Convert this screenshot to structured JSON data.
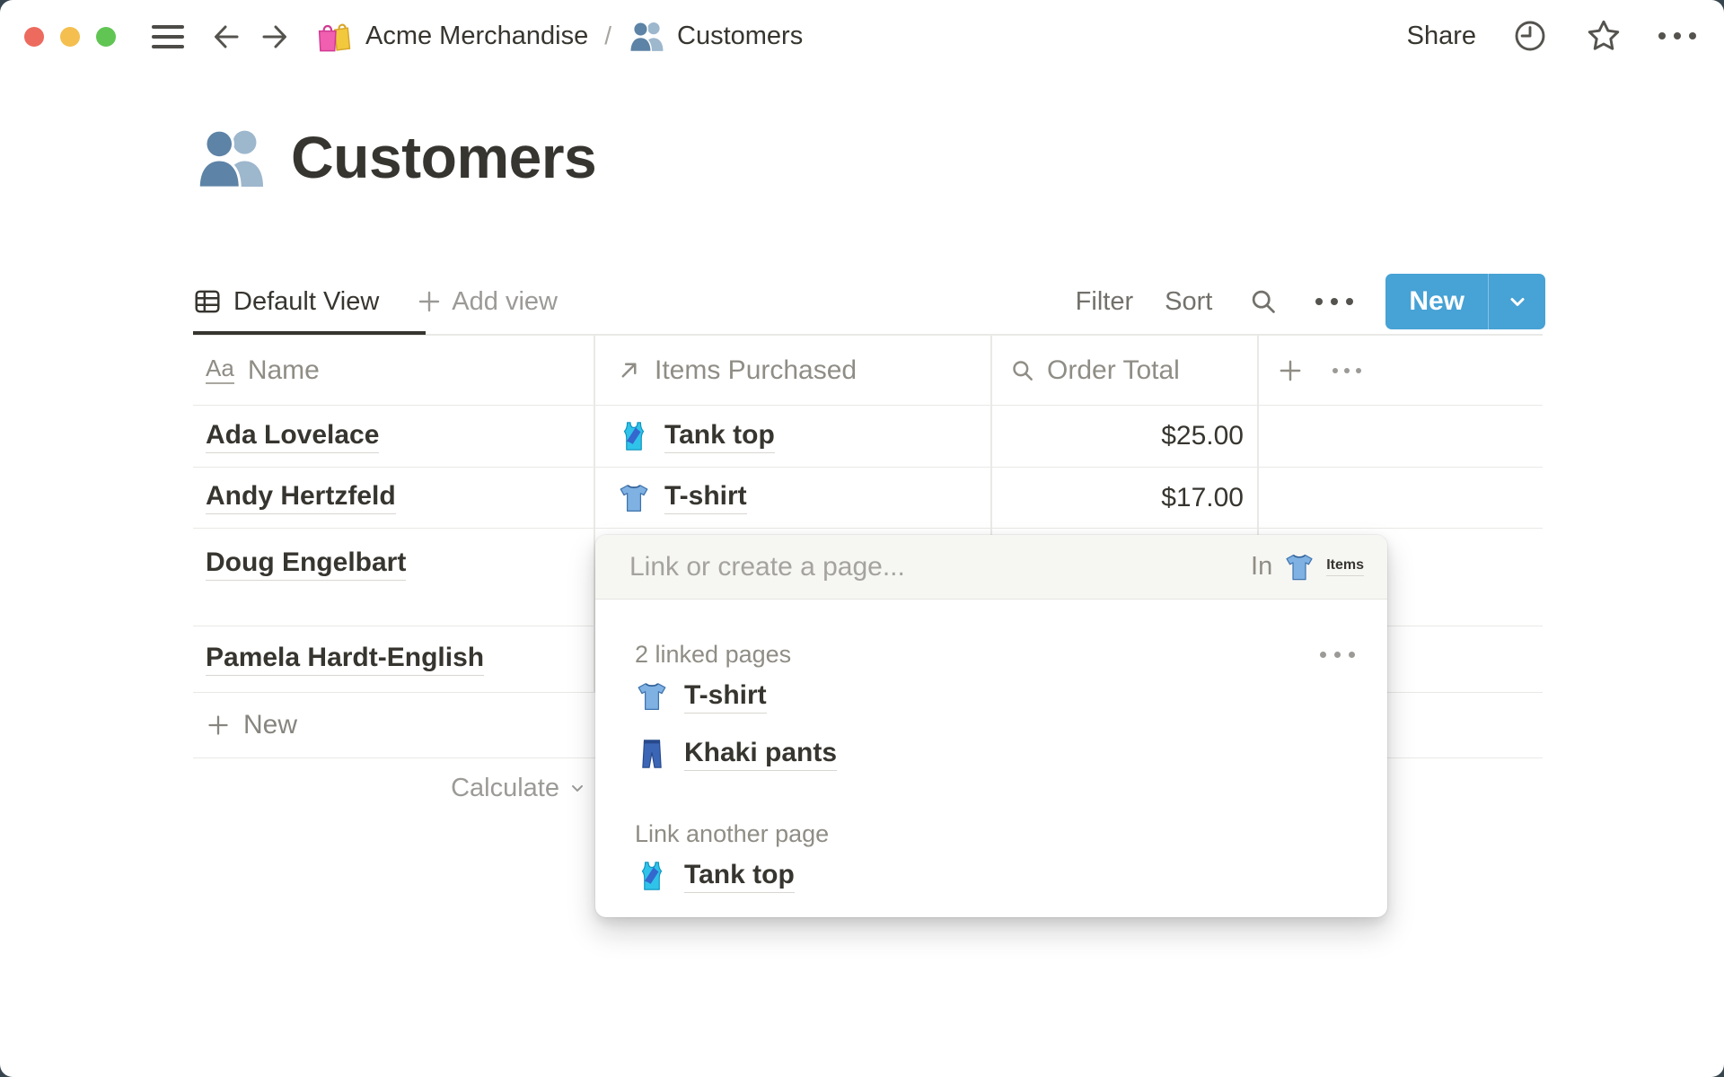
{
  "topbar": {
    "traffic_lights": {
      "close": "#ed6a5e",
      "minimize": "#f4bf4f",
      "zoom": "#61c554"
    },
    "breadcrumb": {
      "workspace": "Acme Merchandise",
      "workspace_icon": "shopping-bags-icon",
      "separator": "/",
      "page": "Customers",
      "page_icon": "people-icon"
    },
    "share_label": "Share",
    "icons": [
      "hamburger-icon",
      "arrow-left-icon",
      "arrow-right-icon",
      "clock-icon",
      "star-icon",
      "more-icon"
    ]
  },
  "page_header": {
    "icon": "people-icon",
    "title": "Customers"
  },
  "view_bar": {
    "default_view_label": "Default View",
    "default_view_icon": "table-view-icon",
    "add_view_label": "Add view",
    "filter_label": "Filter",
    "sort_label": "Sort",
    "new_button_label": "New"
  },
  "table": {
    "columns": [
      {
        "label": "Name",
        "type_icon": "text-property-icon"
      },
      {
        "label": "Items Purchased",
        "type_icon": "relation-arrow-icon"
      },
      {
        "label": "Order Total",
        "type_icon": "rollup-magnifier-icon"
      }
    ],
    "rows": [
      {
        "name": "Ada Lovelace",
        "item": "Tank top",
        "item_icon": "running-shirt-icon",
        "order_total": "$25.00"
      },
      {
        "name": "Andy Hertzfeld",
        "item": "T-shirt",
        "item_icon": "t-shirt-icon",
        "order_total": "$17.00"
      },
      {
        "name": "Doug Engelbart",
        "item": "",
        "item_icon": "",
        "order_total": ""
      },
      {
        "name": "Pamela Hardt-English",
        "item": "",
        "item_icon": "",
        "order_total": ""
      }
    ],
    "new_row_label": "New",
    "calculate_label": "Calculate"
  },
  "link_popup": {
    "input_placeholder": "Link or create a page...",
    "scope_prefix": "In",
    "scope_name": "Items",
    "scope_icon": "t-shirt-icon",
    "linked_pages_heading": "2 linked pages",
    "linked_pages": [
      {
        "label": "T-shirt",
        "icon": "t-shirt-icon"
      },
      {
        "label": "Khaki pants",
        "icon": "jeans-icon"
      }
    ],
    "link_another_heading": "Link another page",
    "suggestions": [
      {
        "label": "Tank top",
        "icon": "running-shirt-icon"
      }
    ]
  },
  "colors": {
    "accent_blue": "#47a2d5",
    "text_dark": "#37352f",
    "text_gray": "#8f8d85",
    "divider": "#e9e9e7",
    "desktop_background": "#36454e",
    "popup_header_background": "#f6f6f3"
  }
}
